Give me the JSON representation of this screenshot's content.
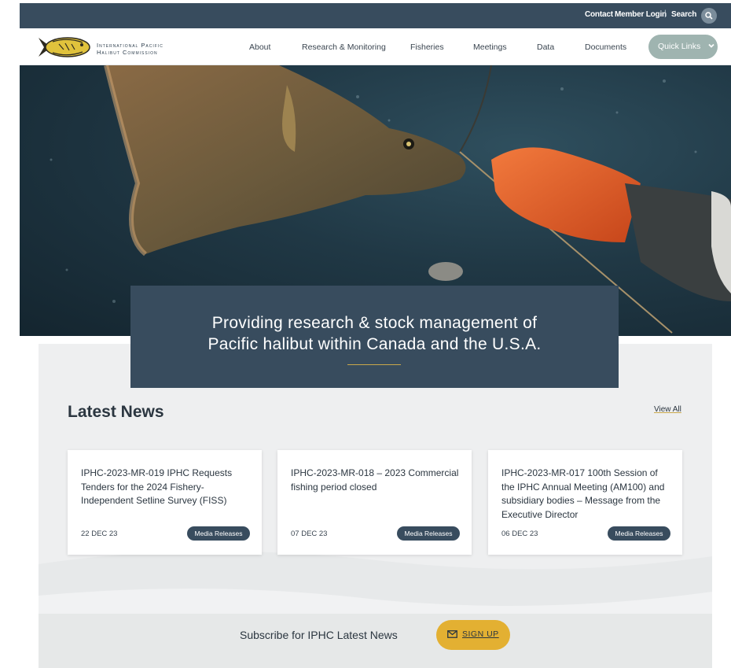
{
  "topbar": {
    "contact": "Contact",
    "member_login": "Member Login",
    "separator": "|",
    "search": "Search",
    "search_icon": "search-icon"
  },
  "header": {
    "logo_line1": "International Pacific",
    "logo_line2": "Halibut Commission",
    "nav": [
      "About",
      "Research & Monitoring",
      "Fisheries",
      "Meetings",
      "Data",
      "Documents"
    ],
    "quick_links": "Quick Links"
  },
  "hero": {
    "tagline_line1": "Providing research & stock management of",
    "tagline_line2": "Pacific halibut within Canada and the U.S.A."
  },
  "news": {
    "title": "Latest News",
    "view_all": "View All",
    "items": [
      {
        "title": "IPHC-2023-MR-019 IPHC Requests Tenders for the 2024 Fishery-Independent Setline Survey (FISS)",
        "date": "22 DEC 23",
        "category": "Media Releases"
      },
      {
        "title": "IPHC-2023-MR-018 – 2023 Commercial fishing period closed",
        "date": "07 DEC 23",
        "category": "Media Releases"
      },
      {
        "title": "IPHC-2023-MR-017 100th Session of the IPHC Annual Meeting (AM100) and subsidiary bodies – Message from the Executive Director",
        "date": "06 DEC 23",
        "category": "Media Releases"
      }
    ]
  },
  "subscribe": {
    "text": "Subscribe for IPHC Latest News",
    "button": "SIGN UP",
    "button_icon": "envelope-icon"
  },
  "colors": {
    "navy": "#384c5e",
    "gold": "#e3b032",
    "quick_links": "#9fb4b0",
    "panel": "#eeeff0"
  }
}
